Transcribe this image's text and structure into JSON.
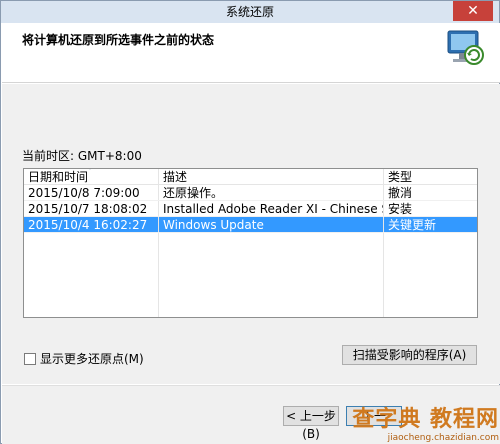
{
  "window": {
    "title": "系统还原",
    "close_glyph": "✕"
  },
  "header": {
    "heading": "将计算机还原到所选事件之前的状态",
    "icon": "system-restore-icon"
  },
  "timezone": "当前时区: GMT+8:00",
  "list": {
    "columns": [
      "日期和时间",
      "描述",
      "类型"
    ],
    "rows": [
      [
        "2015/10/8 7:09:00",
        "还原操作。",
        "撤消"
      ],
      [
        "2015/10/7 18:08:02",
        "Installed Adobe Reader XI - Chinese Simplified.",
        "安装"
      ],
      [
        "2015/10/4 16:02:27",
        "Windows Update",
        "关键更新"
      ]
    ],
    "selected_row": 2
  },
  "options": {
    "show_more": "显示更多还原点(M)",
    "scan": "扫描受影响的程序(A)"
  },
  "footer": {
    "back": "< 上一步(B)",
    "next": "下一"
  },
  "watermark": {
    "line1": "查字典 教程网",
    "line2": "jiaocheng.chazidian.com"
  },
  "colors": {
    "selection": "#3399ff",
    "titlebar": "#d9e4f1",
    "body": "#f0f0f0"
  }
}
